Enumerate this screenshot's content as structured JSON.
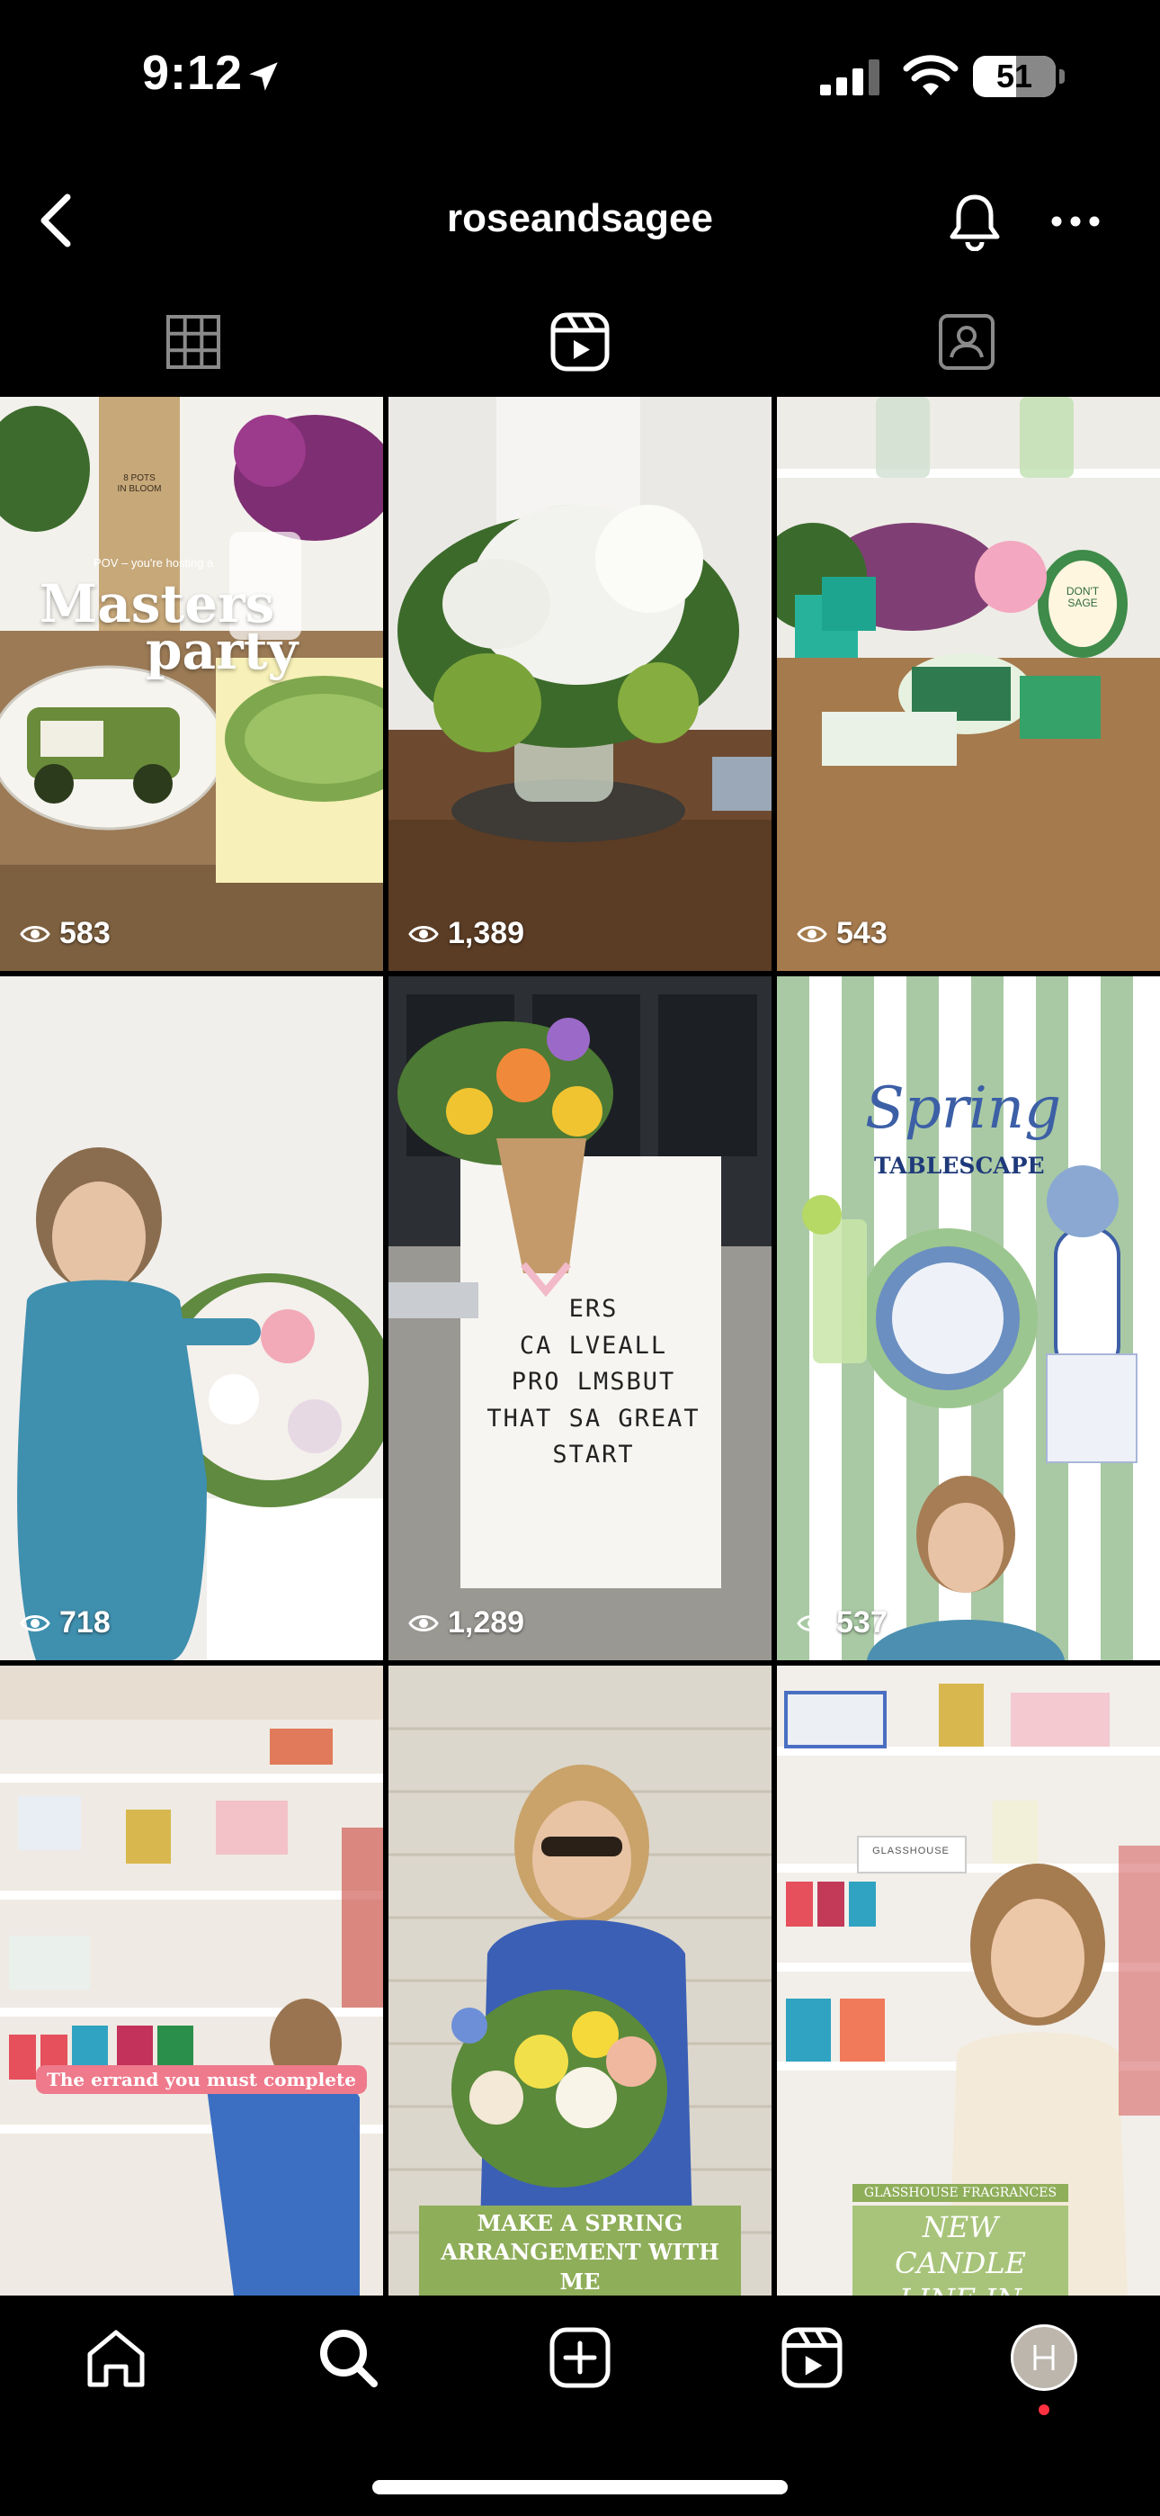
{
  "status_bar": {
    "time": "9:12",
    "battery": "51"
  },
  "header": {
    "username": "roseandsagee"
  },
  "tabs": [
    "grid",
    "reels",
    "tagged"
  ],
  "reels": [
    {
      "views": "583",
      "overlay_small": "POV – you're hosting a",
      "overlay_title_1": "Masters",
      "overlay_title_2": "party",
      "box_label_1": "8 POTS",
      "box_label_2": "IN BLOOM"
    },
    {
      "views": "1,389"
    },
    {
      "views": "543",
      "card_label_1": "DON'T",
      "card_label_2": "SAGE"
    },
    {
      "views": "718"
    },
    {
      "views": "1,289",
      "sign_lines": [
        "ERS",
        "CA  LVEALL",
        "PRO  LMSBUT",
        "THAT SA GREAT",
        "START"
      ]
    },
    {
      "views": "537",
      "overlay_script": "Spring",
      "overlay_caps": "TABLESCAPE"
    },
    {
      "overlay": "The errand you must complete"
    },
    {
      "overlay_line_1": "MAKE A SPRING",
      "overlay_line_2": "ARRANGEMENT WITH ME"
    },
    {
      "overlay_small": "GLASSHOUSE FRAGRANCES",
      "overlay_line_1": "NEW CANDLE",
      "overlay_line_2": "LINE IN STORE",
      "box_label": "GLASSHOUSE"
    }
  ],
  "colors": {
    "background": "#000000",
    "accent_dot": "#ff3040"
  }
}
